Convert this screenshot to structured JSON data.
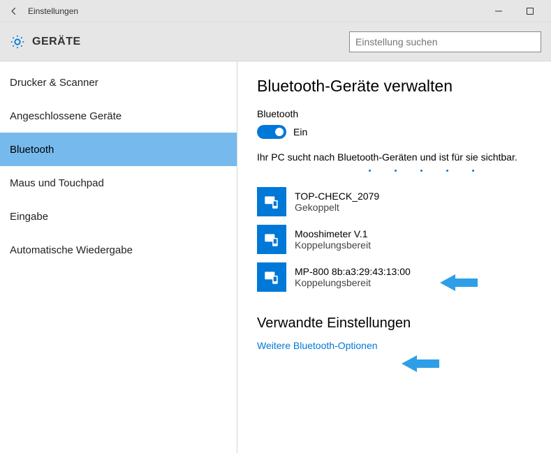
{
  "window": {
    "title": "Einstellungen"
  },
  "header": {
    "category": "GERÄTE"
  },
  "search": {
    "placeholder": "Einstellung suchen"
  },
  "sidebar": {
    "items": [
      {
        "label": "Drucker & Scanner",
        "active": false
      },
      {
        "label": "Angeschlossene Geräte",
        "active": false
      },
      {
        "label": "Bluetooth",
        "active": true
      },
      {
        "label": "Maus und Touchpad",
        "active": false
      },
      {
        "label": "Eingabe",
        "active": false
      },
      {
        "label": "Automatische Wiedergabe",
        "active": false
      }
    ]
  },
  "main": {
    "heading": "Bluetooth-Geräte verwalten",
    "toggle_section_label": "Bluetooth",
    "toggle_state_label": "Ein",
    "toggle_on": true,
    "status_line": "Ihr PC sucht nach Bluetooth-Geräten und ist für sie sichtbar.",
    "devices": [
      {
        "name": "TOP-CHECK_2079",
        "status": "Gekoppelt"
      },
      {
        "name": "Mooshimeter V.1",
        "status": "Koppelungsbereit"
      },
      {
        "name": "MP-800 8b:a3:29:43:13:00",
        "status": "Koppelungsbereit"
      }
    ],
    "related_heading": "Verwandte Einstellungen",
    "related_link": "Weitere Bluetooth-Optionen"
  }
}
